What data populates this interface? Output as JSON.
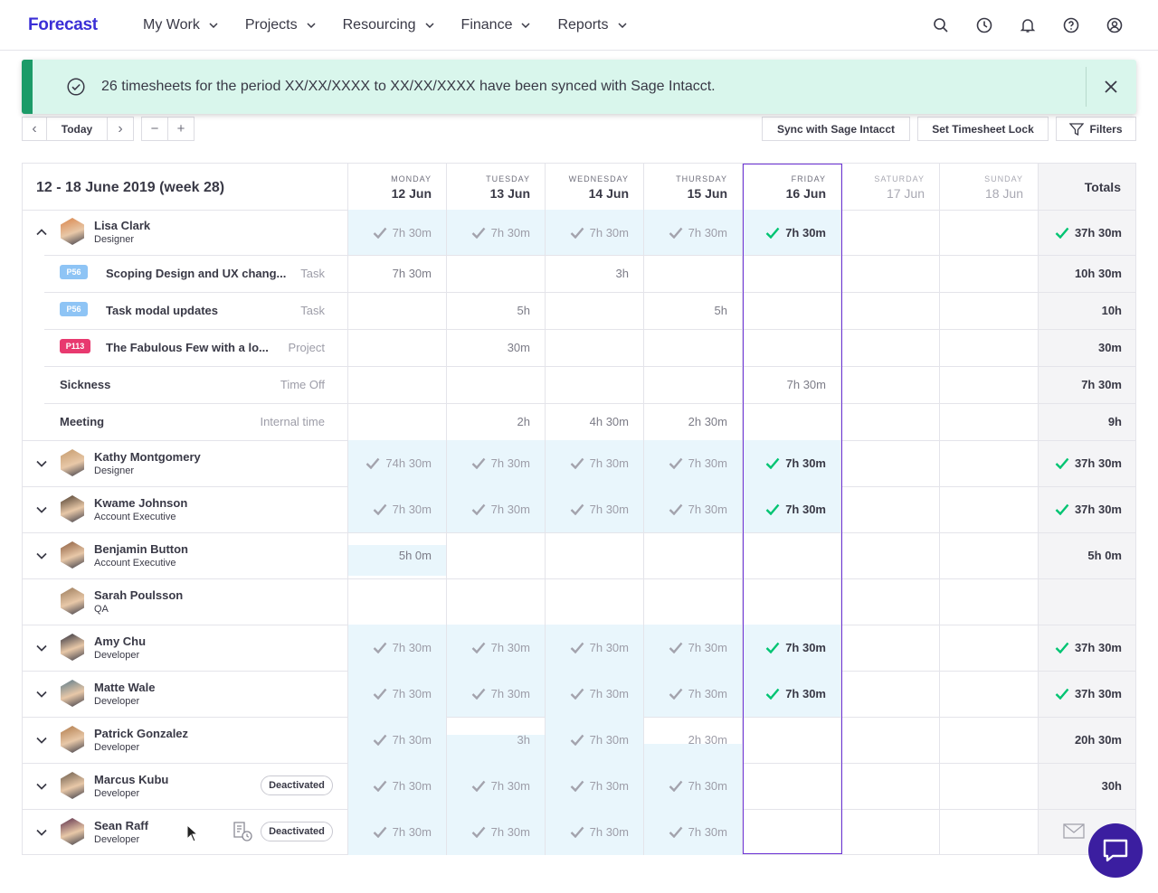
{
  "app": {
    "logo": "Forecast"
  },
  "nav": [
    {
      "label": "My Work"
    },
    {
      "label": "Projects"
    },
    {
      "label": "Resourcing"
    },
    {
      "label": "Finance"
    },
    {
      "label": "Reports"
    }
  ],
  "header_icons": [
    "search-icon",
    "clock-icon",
    "bell-icon",
    "help-icon",
    "user-icon"
  ],
  "toast": {
    "message": "26 timesheets for the period XX/XX/XXXX to XX/XX/XXXX have been synced with Sage Intacct.",
    "color": "#d9f6ec",
    "accent": "#1c9b68"
  },
  "toolbar": {
    "prev": "‹",
    "today": "Today",
    "next": "›",
    "zoom_out": "−",
    "zoom_in": "+",
    "sync": "Sync with Sage Intacct",
    "lock": "Set Timesheet Lock",
    "filters": "Filters"
  },
  "week_title": "12 - 18 June 2019 (week 28)",
  "days": [
    {
      "name": "MONDAY",
      "date": "12 Jun"
    },
    {
      "name": "TUESDAY",
      "date": "13 Jun"
    },
    {
      "name": "WEDNESDAY",
      "date": "14 Jun"
    },
    {
      "name": "THURSDAY",
      "date": "15 Jun"
    },
    {
      "name": "FRIDAY",
      "date": "16 Jun"
    },
    {
      "name": "SATURDAY",
      "date": "17 Jun"
    },
    {
      "name": "SUNDAY",
      "date": "18 Jun"
    }
  ],
  "totals_label": "Totals",
  "lisa": {
    "name": "Lisa Clark",
    "role": "Designer",
    "days": [
      "7h 30m",
      "7h 30m",
      "7h 30m",
      "7h 30m",
      "7h 30m"
    ],
    "total": "37h 30m",
    "rows": [
      {
        "badge": "P56",
        "name": "Scoping Design and UX chang...",
        "type": "Task",
        "values": [
          "7h 30m",
          "",
          "3h",
          "",
          "",
          "",
          ""
        ],
        "total": "10h 30m"
      },
      {
        "badge": "P56",
        "name": "Task modal updates",
        "type": "Task",
        "values": [
          "",
          "5h",
          "",
          "5h",
          "",
          "",
          ""
        ],
        "total": "10h"
      },
      {
        "badge": "P113",
        "name": "The Fabulous Few with a lo...",
        "type": "Project",
        "values": [
          "",
          "30m",
          "",
          "",
          "",
          "",
          ""
        ],
        "total": "30m"
      },
      {
        "badge": "",
        "name": "Sickness",
        "type": "Time Off",
        "values": [
          "",
          "",
          "",
          "",
          "7h 30m",
          "",
          ""
        ],
        "total": "7h 30m"
      },
      {
        "badge": "",
        "name": "Meeting",
        "type": "Internal time",
        "values": [
          "",
          "2h",
          "4h 30m",
          "2h 30m",
          "",
          "",
          ""
        ],
        "total": "9h"
      }
    ]
  },
  "people": [
    {
      "name": "Kathy Montgomery",
      "role": "Designer",
      "days": [
        "74h 30m",
        "7h 30m",
        "7h 30m",
        "7h 30m",
        "7h 30m"
      ],
      "total": "37h 30m"
    },
    {
      "name": "Kwame Johnson",
      "role": "Account Executive",
      "days": [
        "7h 30m",
        "7h 30m",
        "7h 30m",
        "7h 30m",
        "7h 30m"
      ],
      "total": "37h 30m"
    },
    {
      "name": "Benjamin Button",
      "role": "Account Executive",
      "days": [
        "5h 0m",
        "",
        "",
        "",
        ""
      ],
      "total": "5h 0m"
    },
    {
      "name": "Sarah Poulsson",
      "role": "QA",
      "days": [
        "",
        "",
        "",
        "",
        ""
      ],
      "total": ""
    },
    {
      "name": "Amy Chu",
      "role": "Developer",
      "days": [
        "7h 30m",
        "7h 30m",
        "7h 30m",
        "7h 30m",
        "7h 30m"
      ],
      "total": "37h 30m"
    },
    {
      "name": "Matte Wale",
      "role": "Developer",
      "days": [
        "7h 30m",
        "7h 30m",
        "7h 30m",
        "7h 30m",
        "7h 30m"
      ],
      "total": "37h 30m"
    },
    {
      "name": "Patrick Gonzalez",
      "role": "Developer",
      "days": [
        "7h 30m",
        "3h",
        "7h 30m",
        "2h 30m",
        ""
      ],
      "total": "20h 30m"
    },
    {
      "name": "Marcus Kubu",
      "role": "Developer",
      "badge": "Deactivated",
      "days": [
        "7h 30m",
        "7h 30m",
        "7h 30m",
        "7h 30m",
        ""
      ],
      "total": "30h"
    },
    {
      "name": "Sean Raff",
      "role": "Developer",
      "badge": "Deactivated",
      "days": [
        "7h 30m",
        "7h 30m",
        "7h 30m",
        "7h 30m",
        ""
      ],
      "total": ""
    }
  ],
  "colors": {
    "brand": "#3b2fd6",
    "approved": "#00c472",
    "friday_outline": "#6e35d6",
    "badge_p56": "#8ec4f5",
    "badge_p113": "#e8396f"
  }
}
